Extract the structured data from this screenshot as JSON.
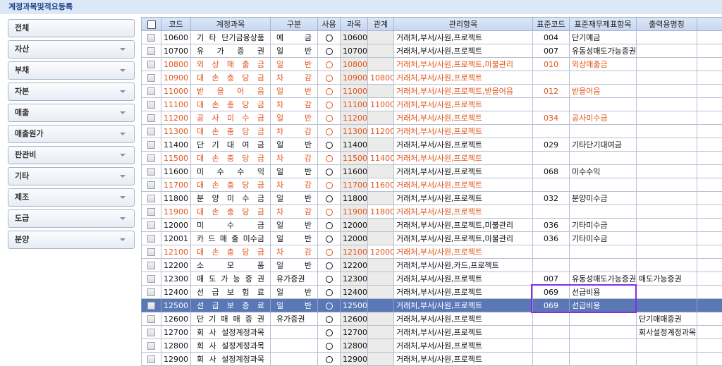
{
  "title": "계정과목및적요등록",
  "sidebar": [
    "전체",
    "자산",
    "부채",
    "자본",
    "매출",
    "매출원가",
    "판관비",
    "기타",
    "제조",
    "도급",
    "분양"
  ],
  "headers": {
    "code": "코드",
    "name": "계정과목",
    "type": "구분",
    "use": "사용",
    "subject": "과목",
    "relation": "관계",
    "mgmt": "관리항목",
    "stdcode": "표준코드",
    "stditem": "표준재무제표항목",
    "printname": "출력용명칭"
  },
  "colors": {
    "red": "#e2531a",
    "selected": "#5b78b6",
    "highlight": "#8a2be2"
  },
  "rows": [
    {
      "code": "10600",
      "name": "기 타 단기금융상품",
      "type": "예 금",
      "use": "○",
      "subject": "10600",
      "relation": "",
      "mgmt": "거래처,부서/사원,프로젝트",
      "stdcode": "004",
      "stditem": "단기예금",
      "printname": "",
      "red": false
    },
    {
      "code": "10700",
      "name": "유 가 증 권",
      "type": "일 반",
      "use": "○",
      "subject": "10700",
      "relation": "",
      "mgmt": "거래처,부서/사원,프로젝트",
      "stdcode": "007",
      "stditem": "유동성매도가능증권",
      "printname": "",
      "red": false
    },
    {
      "code": "10800",
      "name": "외 상 매 출 금",
      "type": "일 반",
      "use": "○",
      "subject": "10800",
      "relation": "",
      "mgmt": "거래처,부서/사원,프로젝트,미불관리",
      "stdcode": "010",
      "stditem": "외상매출금",
      "printname": "",
      "red": true
    },
    {
      "code": "10900",
      "name": "대 손 충 당 금",
      "type": "차 감",
      "use": "○",
      "subject": "10900",
      "relation": "10800",
      "mgmt": "거래처,부서/사원,프로젝트",
      "stdcode": "",
      "stditem": "",
      "printname": "",
      "red": true
    },
    {
      "code": "11000",
      "name": "받 을 어 음",
      "type": "일 반",
      "use": "○",
      "subject": "11000",
      "relation": "",
      "mgmt": "거래처,부서/사원,프로젝트,받을어음",
      "stdcode": "012",
      "stditem": "받을어음",
      "printname": "",
      "red": true
    },
    {
      "code": "11100",
      "name": "대 손 충 당 금",
      "type": "차 감",
      "use": "○",
      "subject": "11100",
      "relation": "11000",
      "mgmt": "거래처,부서/사원,프로젝트",
      "stdcode": "",
      "stditem": "",
      "printname": "",
      "red": true
    },
    {
      "code": "11200",
      "name": "공 사 미 수 금",
      "type": "일 반",
      "use": "○",
      "subject": "11200",
      "relation": "",
      "mgmt": "거래처,부서/사원,프로젝트",
      "stdcode": "034",
      "stditem": "공사미수금",
      "printname": "",
      "red": true
    },
    {
      "code": "11300",
      "name": "대 손 충 당 금",
      "type": "차 감",
      "use": "○",
      "subject": "11300",
      "relation": "11200",
      "mgmt": "거래처,부서/사원,프로젝트",
      "stdcode": "",
      "stditem": "",
      "printname": "",
      "red": true
    },
    {
      "code": "11400",
      "name": "단 기 대 여 금",
      "type": "일 반",
      "use": "○",
      "subject": "11400",
      "relation": "",
      "mgmt": "거래처,부서/사원,프로젝트",
      "stdcode": "029",
      "stditem": "기타단기대여금",
      "printname": "",
      "red": false
    },
    {
      "code": "11500",
      "name": "대 손 충 당 금",
      "type": "차 감",
      "use": "○",
      "subject": "11500",
      "relation": "11400",
      "mgmt": "거래처,부서/사원,프로젝트",
      "stdcode": "",
      "stditem": "",
      "printname": "",
      "red": true
    },
    {
      "code": "11600",
      "name": "미 수 수 익",
      "type": "일 반",
      "use": "○",
      "subject": "11600",
      "relation": "",
      "mgmt": "거래처,부서/사원,프로젝트",
      "stdcode": "068",
      "stditem": "미수수익",
      "printname": "",
      "red": false
    },
    {
      "code": "11700",
      "name": "대 손 충 당 금",
      "type": "차 감",
      "use": "○",
      "subject": "11700",
      "relation": "11600",
      "mgmt": "거래처,부서/사원,프로젝트",
      "stdcode": "",
      "stditem": "",
      "printname": "",
      "red": true
    },
    {
      "code": "11800",
      "name": "분 양 미 수 금",
      "type": "일 반",
      "use": "○",
      "subject": "11800",
      "relation": "",
      "mgmt": "거래처,부서/사원,프로젝트",
      "stdcode": "032",
      "stditem": "분양미수금",
      "printname": "",
      "red": false
    },
    {
      "code": "11900",
      "name": "대 손 충 당 금",
      "type": "차 감",
      "use": "○",
      "subject": "11900",
      "relation": "11800",
      "mgmt": "거래처,부서/사원,프로젝트",
      "stdcode": "",
      "stditem": "",
      "printname": "",
      "red": true
    },
    {
      "code": "12000",
      "name": "미 수 금",
      "type": "일 반",
      "use": "○",
      "subject": "12000",
      "relation": "",
      "mgmt": "거래처,부서/사원,프로젝트,미불관리",
      "stdcode": "036",
      "stditem": "기타미수금",
      "printname": "",
      "red": false
    },
    {
      "code": "12001",
      "name": "카 드 매 출 미수금",
      "type": "일 반",
      "use": "○",
      "subject": "12000",
      "relation": "",
      "mgmt": "거래처,부서/사원,프로젝트,미불관리",
      "stdcode": "036",
      "stditem": "기타미수금",
      "printname": "",
      "red": false
    },
    {
      "code": "12100",
      "name": "대 손 충 당 금",
      "type": "차 감",
      "use": "○",
      "subject": "12100",
      "relation": "12000",
      "mgmt": "거래처,부서/사원,프로젝트",
      "stdcode": "",
      "stditem": "",
      "printname": "",
      "red": true
    },
    {
      "code": "12200",
      "name": "소 모 품",
      "type": "일 반",
      "use": "○",
      "subject": "12200",
      "relation": "",
      "mgmt": "거래처,부서/사원,카드,프로젝트",
      "stdcode": "",
      "stditem": "",
      "printname": "",
      "red": false
    },
    {
      "code": "12300",
      "name": "매 도 가 능 증 권",
      "type": "유가증권",
      "use": "○",
      "subject": "12300",
      "relation": "",
      "mgmt": "거래처,부서/사원,프로젝트",
      "stdcode": "007",
      "stditem": "유동성매도가능증권",
      "printname": "매도가능증권",
      "red": false
    },
    {
      "code": "12400",
      "name": "선 급 보 험 료",
      "type": "일 반",
      "use": "○",
      "subject": "12400",
      "relation": "",
      "mgmt": "거래처,부서/사원,프로젝트",
      "stdcode": "069",
      "stditem": "선급비용",
      "printname": "",
      "red": false
    },
    {
      "code": "12500",
      "name": "선 급 보 증 료",
      "type": "일 반",
      "use": "○",
      "subject": "12500",
      "relation": "",
      "mgmt": "거래처,부서/사원,프로젝트",
      "stdcode": "069",
      "stditem": "선급비용",
      "printname": "",
      "red": false,
      "selected": true
    },
    {
      "code": "12600",
      "name": "단 기 매 매 증 권",
      "type": "유가증권",
      "use": "○",
      "subject": "12600",
      "relation": "",
      "mgmt": "거래처,부서/사원,프로젝트",
      "stdcode": "",
      "stditem": "",
      "printname": "단기매매증권",
      "red": false
    },
    {
      "code": "12700",
      "name": "회 사 설정계정과목",
      "type": "",
      "use": "○",
      "subject": "12700",
      "relation": "",
      "mgmt": "거래처,부서/사원,프로젝트",
      "stdcode": "",
      "stditem": "",
      "printname": "회사설정계정과목",
      "red": false
    },
    {
      "code": "12800",
      "name": "회 사 설정계정과목",
      "type": "",
      "use": "○",
      "subject": "12800",
      "relation": "",
      "mgmt": "거래처,부서/사원,프로젝트",
      "stdcode": "",
      "stditem": "",
      "printname": "",
      "red": false
    },
    {
      "code": "12900",
      "name": "회 사 설정계정과목",
      "type": "",
      "use": "○",
      "subject": "12900",
      "relation": "",
      "mgmt": "거래처,부서/사원,프로젝트",
      "stdcode": "",
      "stditem": "",
      "printname": "",
      "red": false
    }
  ]
}
